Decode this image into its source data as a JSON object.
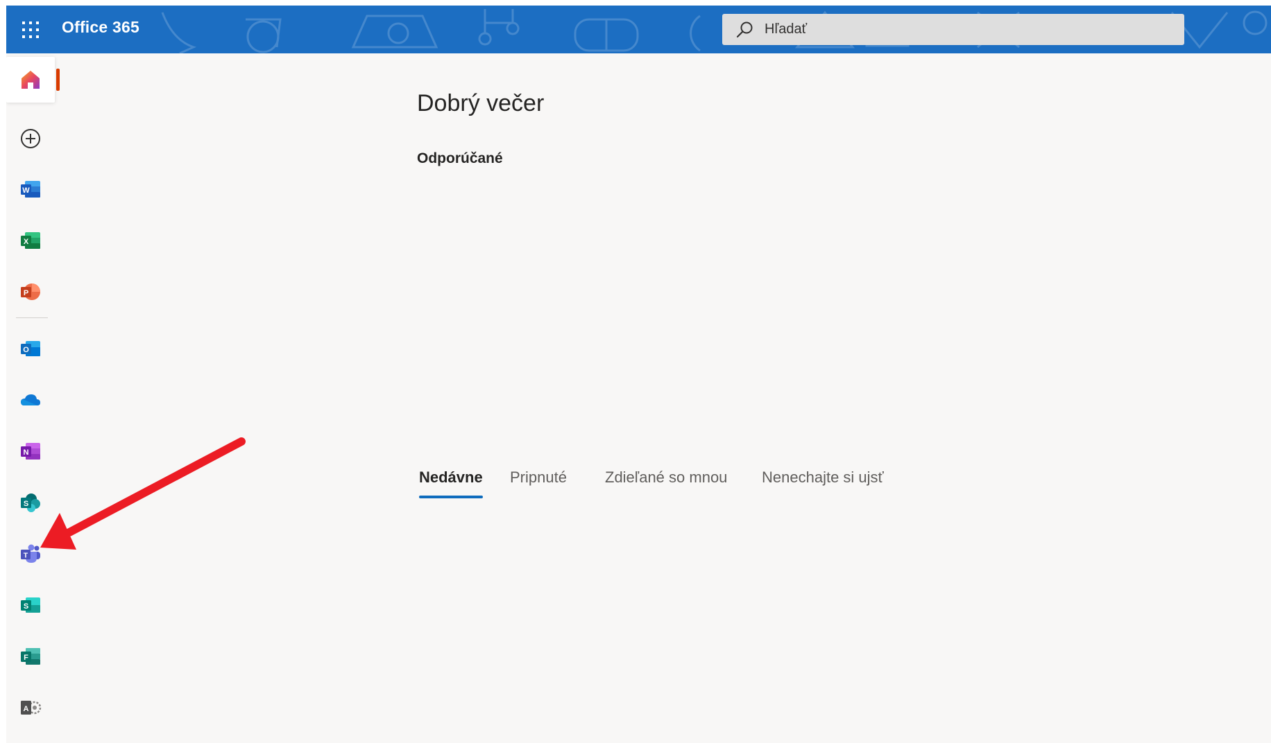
{
  "header": {
    "brand": "Office 365",
    "search_placeholder": "Hľadať",
    "accent": "#1c6ec2"
  },
  "rail": {
    "active_accent": "#d83b01",
    "items": [
      {
        "name": "home",
        "icon": "home-icon",
        "active": true
      },
      {
        "name": "create",
        "icon": "add-circle-icon"
      },
      {
        "name": "word",
        "icon": "word-icon",
        "letter": "W",
        "color": "#185abd"
      },
      {
        "name": "excel",
        "icon": "excel-icon",
        "letter": "X",
        "color": "#107c41"
      },
      {
        "name": "powerpoint",
        "icon": "powerpoint-icon",
        "letter": "P",
        "color": "#c43e1c"
      },
      {
        "name": "outlook",
        "icon": "outlook-icon",
        "letter": "O",
        "color": "#0f6cbd"
      },
      {
        "name": "onedrive",
        "icon": "onedrive-icon",
        "color": "#0f78d4"
      },
      {
        "name": "onenote",
        "icon": "onenote-icon",
        "letter": "N",
        "color": "#7719aa"
      },
      {
        "name": "sharepoint",
        "icon": "sharepoint-icon",
        "letter": "S",
        "color": "#03787c"
      },
      {
        "name": "teams",
        "icon": "teams-icon",
        "letter": "T",
        "color": "#5059c9"
      },
      {
        "name": "sway",
        "icon": "sway-icon",
        "letter": "S",
        "color": "#008272"
      },
      {
        "name": "forms",
        "icon": "forms-icon",
        "letter": "F",
        "color": "#077568"
      },
      {
        "name": "admin",
        "icon": "admin-icon",
        "letter": "A",
        "color": "#505050"
      }
    ]
  },
  "main": {
    "greeting": "Dobrý večer",
    "recommended_title": "Odporúčané",
    "tabs": [
      {
        "label": "Nedávne",
        "selected": true
      },
      {
        "label": "Pripnuté"
      },
      {
        "label": "Zdieľané so mnou"
      },
      {
        "label": "Nenechajte si ujsť"
      }
    ],
    "tab_accent": "#0f6cbd"
  },
  "annotation": {
    "arrow_color": "#ec1c24",
    "points_to": "teams"
  }
}
